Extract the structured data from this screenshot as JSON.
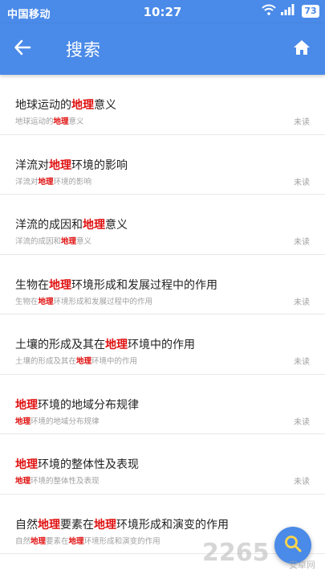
{
  "statusbar": {
    "carrier": "中国移动",
    "time": "10:27",
    "battery": "73"
  },
  "appbar": {
    "title": "搜索"
  },
  "items": [
    {
      "parts": [
        [
          "地球运动的",
          false
        ],
        [
          "地理",
          true
        ],
        [
          "意义",
          false
        ]
      ],
      "status": "未读"
    },
    {
      "parts": [
        [
          "洋流对",
          false
        ],
        [
          "地理",
          true
        ],
        [
          "环境的影响",
          false
        ]
      ],
      "status": "未读"
    },
    {
      "parts": [
        [
          "洋流的成因和",
          false
        ],
        [
          "地理",
          true
        ],
        [
          "意义",
          false
        ]
      ],
      "status": "未读"
    },
    {
      "parts": [
        [
          "生物在",
          false
        ],
        [
          "地理",
          true
        ],
        [
          "环境形成和发展过程中的作用",
          false
        ]
      ],
      "status": "未读"
    },
    {
      "parts": [
        [
          "土壤的形成及其在",
          false
        ],
        [
          "地理",
          true
        ],
        [
          "环境中的作用",
          false
        ]
      ],
      "status": "未读"
    },
    {
      "parts": [
        [
          "地理",
          true
        ],
        [
          "环境的地域分布规律",
          false
        ]
      ],
      "status": "未读"
    },
    {
      "parts": [
        [
          "地理",
          true
        ],
        [
          "环境的整体性及表现",
          false
        ]
      ],
      "status": "未读"
    },
    {
      "parts": [
        [
          "自然",
          false
        ],
        [
          "地理",
          true
        ],
        [
          "要素在",
          false
        ],
        [
          "地理",
          true
        ],
        [
          "环境形成和演变的作用",
          false
        ]
      ],
      "status": ""
    }
  ],
  "watermark": {
    "text": "2265",
    "sub": "安卓网"
  },
  "colors": {
    "primary": "#4a8ae8",
    "highlight": "#e01010",
    "muted": "#a0a0a0"
  },
  "icons": {
    "back": "arrow-left-icon",
    "home": "home-icon",
    "fab": "search-icon"
  }
}
